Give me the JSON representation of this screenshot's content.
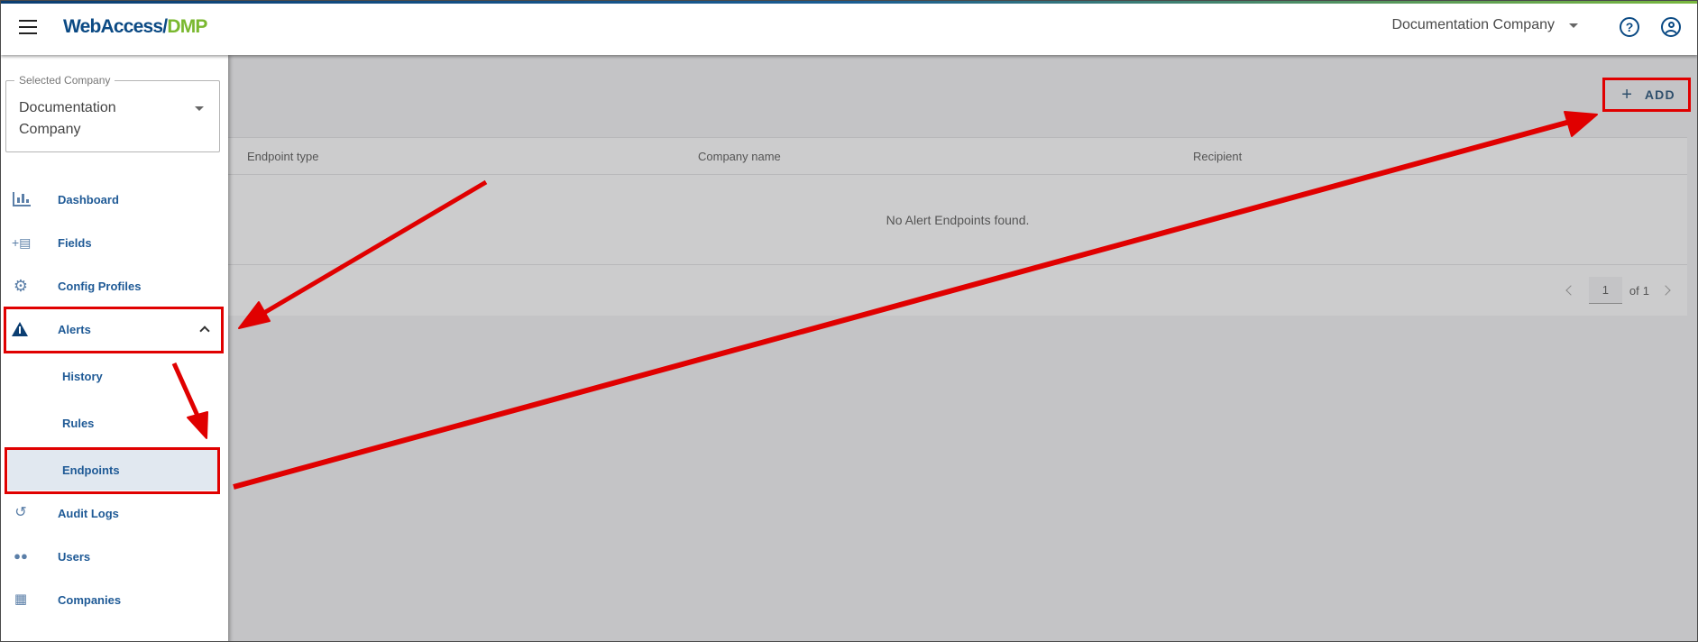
{
  "header": {
    "logo_primary": "WebAccess/",
    "logo_accent": "DMP",
    "company": "Documentation Company",
    "help_glyph": "?"
  },
  "sidebar": {
    "selected_company_label": "Selected Company",
    "selected_company_value": "Documentation Company",
    "items": [
      {
        "label": "Dashboard",
        "icon": "bar-chart-icon"
      },
      {
        "label": "Fields",
        "icon": "fields-icon"
      },
      {
        "label": "Config Profiles",
        "icon": "gear-icon"
      },
      {
        "label": "Alerts",
        "icon": "warning-icon"
      },
      {
        "label": "History"
      },
      {
        "label": "Rules"
      },
      {
        "label": "Endpoints"
      },
      {
        "label": "Audit Logs",
        "icon": "history-icon"
      },
      {
        "label": "Users",
        "icon": "users-icon"
      },
      {
        "label": "Companies",
        "icon": "building-icon"
      }
    ]
  },
  "toolbar": {
    "add_label": "ADD"
  },
  "table": {
    "columns": [
      "Endpoint type",
      "Company name",
      "Recipient"
    ],
    "empty_message": "No Alert Endpoints found."
  },
  "pager": {
    "current_page": "1",
    "of_label": "of",
    "total_pages": "1"
  },
  "colors": {
    "brand_blue": "#0b4a84",
    "brand_green": "#7ab82f",
    "annotation_red": "#e00000"
  }
}
